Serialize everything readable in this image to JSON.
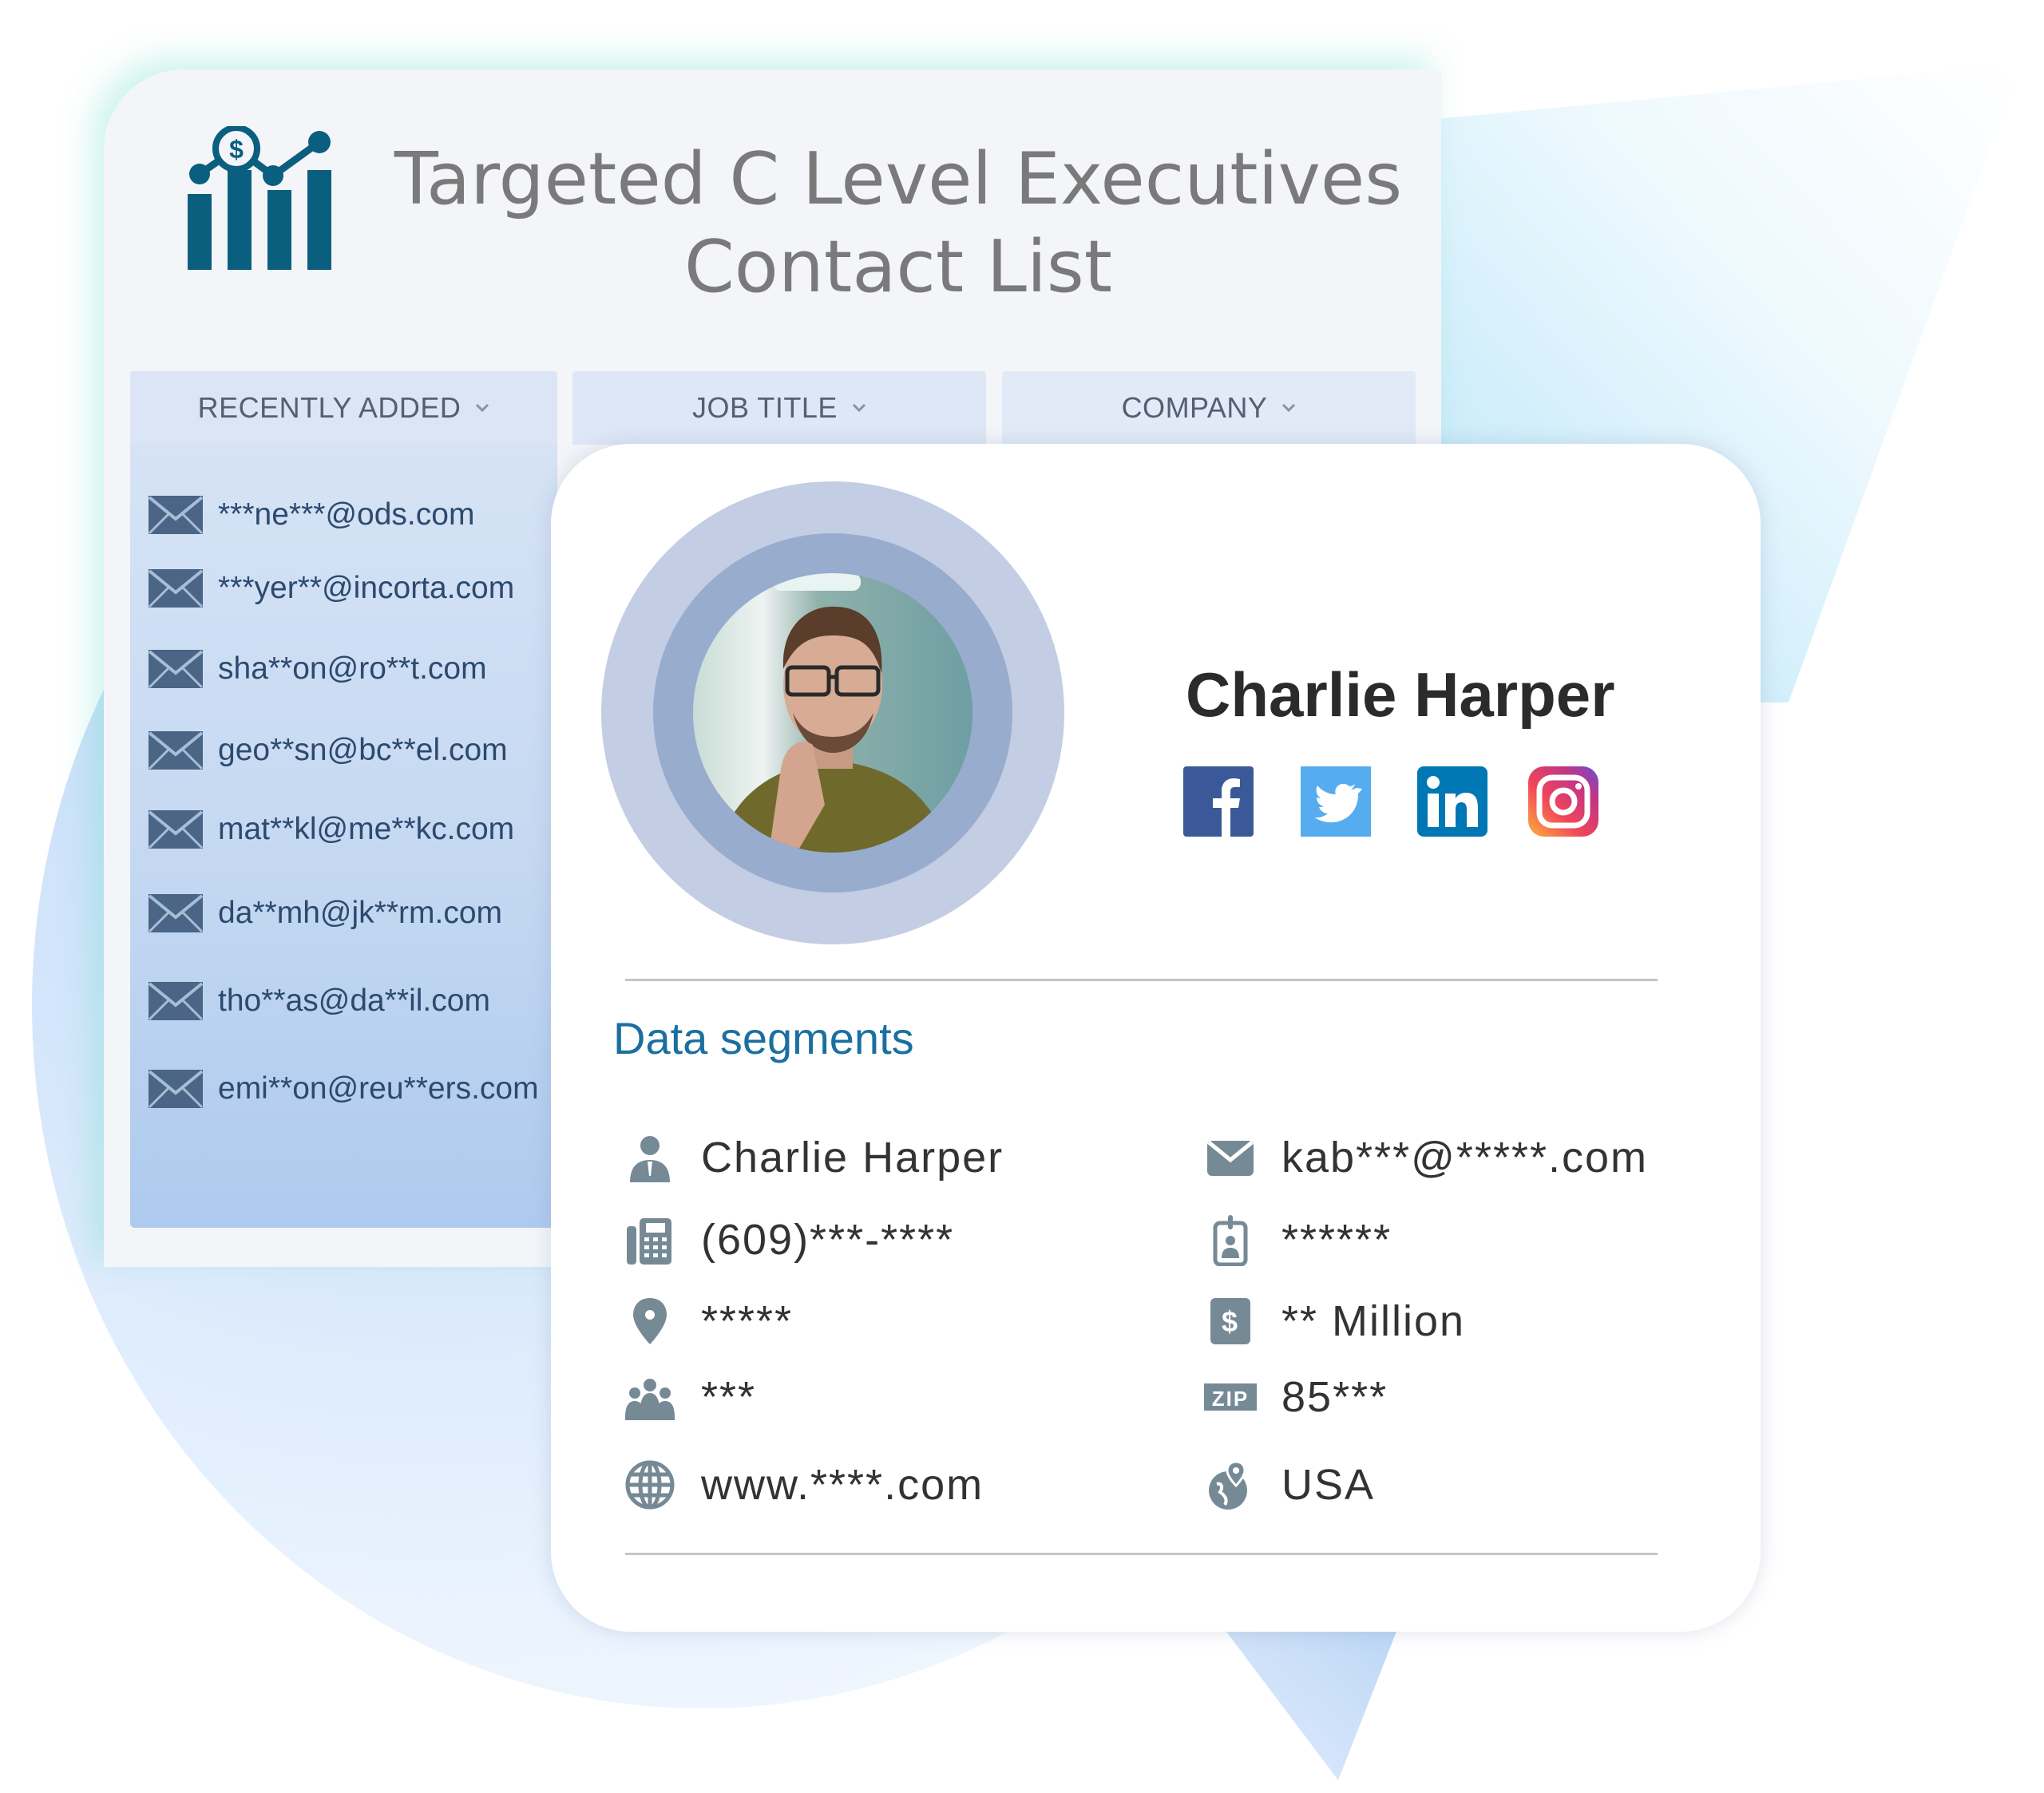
{
  "header": {
    "title_line1": "Targeted C Level Executives",
    "title_line2": "Contact List",
    "logo_icon": "chart-dollar-icon"
  },
  "tabs": [
    {
      "label": "RECENTLY ADDED",
      "icon": "chevron-down-icon"
    },
    {
      "label": "JOB TITLE",
      "icon": "chevron-down-icon"
    },
    {
      "label": "COMPANY",
      "icon": "chevron-down-icon"
    }
  ],
  "recent_emails": [
    "***ne***@ods.com",
    "***yer**@incorta.com",
    "sha**on@ro**t.com",
    "geo**sn@bc**el.com",
    "mat**kl@me**kc.com",
    "da**mh@jk**rm.com",
    "tho**as@da**il.com",
    "emi**on@reu**ers.com"
  ],
  "profile": {
    "name": "Charlie Harper",
    "social": [
      {
        "name": "facebook",
        "icon": "facebook-icon",
        "color": "#3b5998"
      },
      {
        "name": "twitter",
        "icon": "twitter-icon",
        "color": "#55acee"
      },
      {
        "name": "linkedin",
        "icon": "linkedin-icon",
        "color": "#0077b5"
      },
      {
        "name": "instagram",
        "icon": "instagram-icon",
        "color": "#c13584"
      }
    ]
  },
  "data_segments": {
    "title": "Data segments",
    "left": [
      {
        "icon": "person-icon",
        "value": "Charlie Harper"
      },
      {
        "icon": "phone-icon",
        "value": "(609)***-****"
      },
      {
        "icon": "location-pin-icon",
        "value": "*****"
      },
      {
        "icon": "team-icon",
        "value": "***"
      },
      {
        "icon": "globe-icon",
        "value": "www.****.com"
      }
    ],
    "right": [
      {
        "icon": "email-icon",
        "value": "kab***@*****.com"
      },
      {
        "icon": "id-badge-icon",
        "value": "******"
      },
      {
        "icon": "dollar-icon",
        "value": "** Million"
      },
      {
        "icon": "zip-icon",
        "value": "85***"
      },
      {
        "icon": "globe-pin-icon",
        "value": "USA"
      }
    ]
  },
  "colors": {
    "accent": "#1b6fa0",
    "logo": "#0b5f7e",
    "icon_gray": "#768a96",
    "email_icon": "#4a6585"
  }
}
